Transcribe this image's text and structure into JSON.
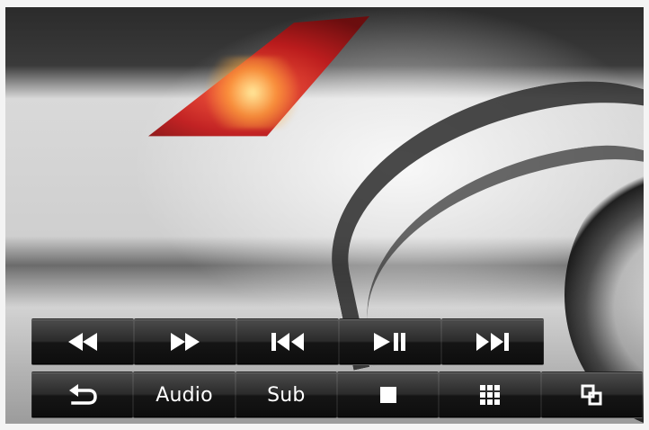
{
  "player": {
    "row1": [
      {
        "id": "rewind",
        "icon": "rewind-icon"
      },
      {
        "id": "fast-forward",
        "icon": "fast-forward-icon"
      },
      {
        "id": "previous",
        "icon": "skip-previous-icon"
      },
      {
        "id": "play-pause",
        "icon": "play-pause-icon"
      },
      {
        "id": "next",
        "icon": "skip-next-icon"
      }
    ],
    "row2": [
      {
        "id": "back",
        "icon": "back-arrow-icon"
      },
      {
        "id": "audio",
        "label": "Audio"
      },
      {
        "id": "subtitle",
        "label": "Sub"
      },
      {
        "id": "stop",
        "icon": "stop-icon"
      },
      {
        "id": "menu",
        "icon": "grid-icon"
      },
      {
        "id": "aspect",
        "icon": "overlapping-squares-icon"
      }
    ]
  }
}
